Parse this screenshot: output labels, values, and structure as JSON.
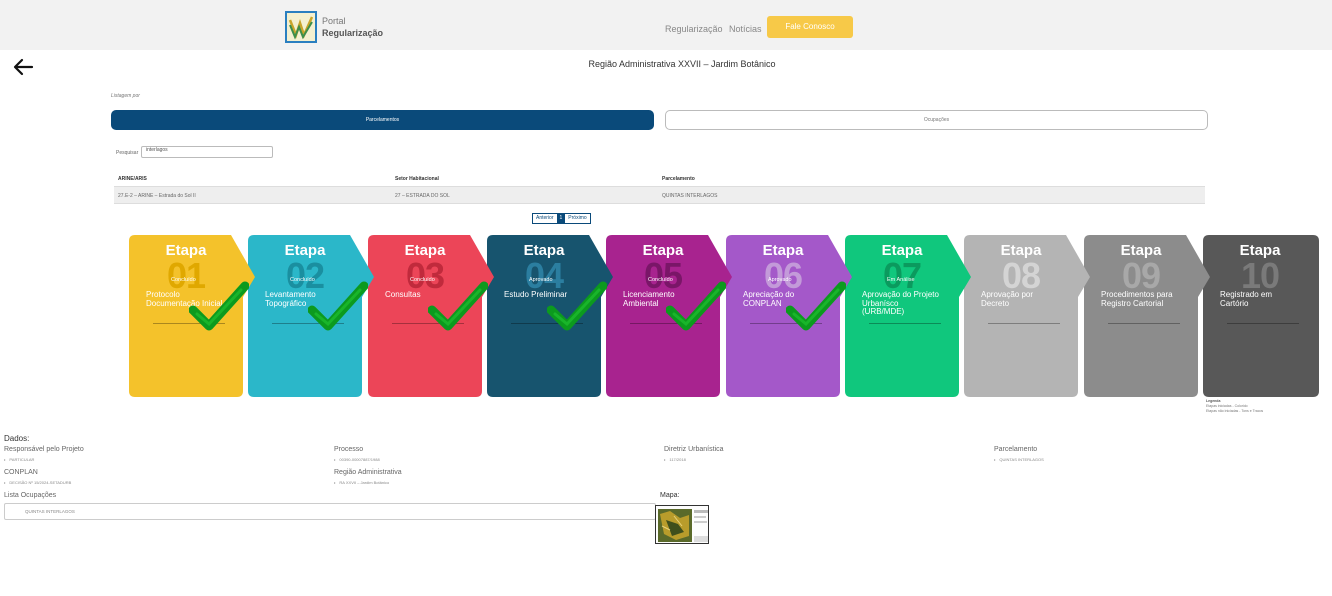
{
  "header": {
    "brand_line1": "Portal",
    "brand_line2": "Regularização",
    "nav": [
      "Regularização",
      "Notícias"
    ],
    "cta": "Fale Conosco"
  },
  "page": {
    "title": "Região Administrativa XXVII – Jardim Botânico",
    "listagem_label": "Listagem por",
    "tabs": [
      "Parcelamentos",
      "Ocupações"
    ],
    "search_label": "Pesquisar",
    "search_value": "interlagos"
  },
  "table": {
    "headers": [
      "ARINE/ARIS",
      "Setor Habitacional",
      "Parcelamento"
    ],
    "rows": [
      [
        "27.E-2 – ARINE – Estrada do Sol II",
        "27 – ESTRADA DO SOL",
        "QUINTAS INTERLAGOS"
      ]
    ]
  },
  "pager": {
    "prev": "Anterior",
    "current": "1",
    "next": "Próximo"
  },
  "steps": [
    {
      "label": "Etapa",
      "num": "01",
      "status": "Concluído",
      "title": "Protocolo Documentação Inicial",
      "color": "#f4c22b",
      "numcolor": "#e0a800",
      "checked": true
    },
    {
      "label": "Etapa",
      "num": "02",
      "status": "Concluído",
      "title": "Levantamento Topográfico",
      "color": "#2bb7c9",
      "numcolor": "#1a8fa0",
      "checked": true
    },
    {
      "label": "Etapa",
      "num": "03",
      "status": "Concluído",
      "title": "Consultas",
      "color": "#ec4558",
      "numcolor": "#c02a3c",
      "checked": true
    },
    {
      "label": "Etapa",
      "num": "04",
      "status": "Aprovado",
      "title": "Estudo Preliminar",
      "color": "#17546e",
      "numcolor": "#2b7ea0",
      "checked": true
    },
    {
      "label": "Etapa",
      "num": "05",
      "status": "Concluído",
      "title": "Licenciamento Ambiental",
      "color": "#a8238f",
      "numcolor": "#7a1668",
      "checked": true
    },
    {
      "label": "Etapa",
      "num": "06",
      "status": "Aprovado",
      "title": "Apreciação do CONPLAN",
      "color": "#a458c9",
      "numcolor": "#c39ad9",
      "checked": true
    },
    {
      "label": "Etapa",
      "num": "07",
      "status": "Em Análise",
      "title": "Aprovação do Projeto Urbanísco (URB/MDE)",
      "color": "#10c77d",
      "numcolor": "#0b9a5e",
      "checked": false
    },
    {
      "label": "Etapa",
      "num": "08",
      "status": "",
      "title": "Aprovação por Decreto",
      "color": "#b4b4b4",
      "numcolor": "#d4d4d4",
      "checked": false
    },
    {
      "label": "Etapa",
      "num": "09",
      "status": "",
      "title": "Procedimentos para Registro Cartorial",
      "color": "#8c8c8c",
      "numcolor": "#a8a8a8",
      "checked": false
    },
    {
      "label": "Etapa",
      "num": "10",
      "status": "",
      "title": "Registrado em Cartório",
      "color": "#585858",
      "numcolor": "#7a7a7a",
      "checked": false
    }
  ],
  "legend": {
    "title": "Legenda",
    "line1": "Etapas iniciadas - Colorido",
    "line2": "Etapas não iniciadas - Tons e Tracos"
  },
  "dados": {
    "title": "Dados:",
    "fields": [
      {
        "label": "Responsável pelo Projeto",
        "value": "PARTICULAR"
      },
      {
        "label": "Processo",
        "value": "00390-00007887/1988"
      },
      {
        "label": "Diretriz Urbanística",
        "value": "117/2018"
      },
      {
        "label": "Parcelamento",
        "value": "QUINTAS INTERLAGOS"
      },
      {
        "label": "CONPLAN",
        "value": "DECISÃO Nº 15/2024-SETADURB"
      },
      {
        "label": "Região Administrativa",
        "value": "RA XXVII – Jardim Botânico"
      }
    ],
    "ocupacoes_label": "Lista Ocupações",
    "ocupacoes_value": "QUINTAS INTERLAGOS",
    "mapa_label": "Mapa:"
  }
}
